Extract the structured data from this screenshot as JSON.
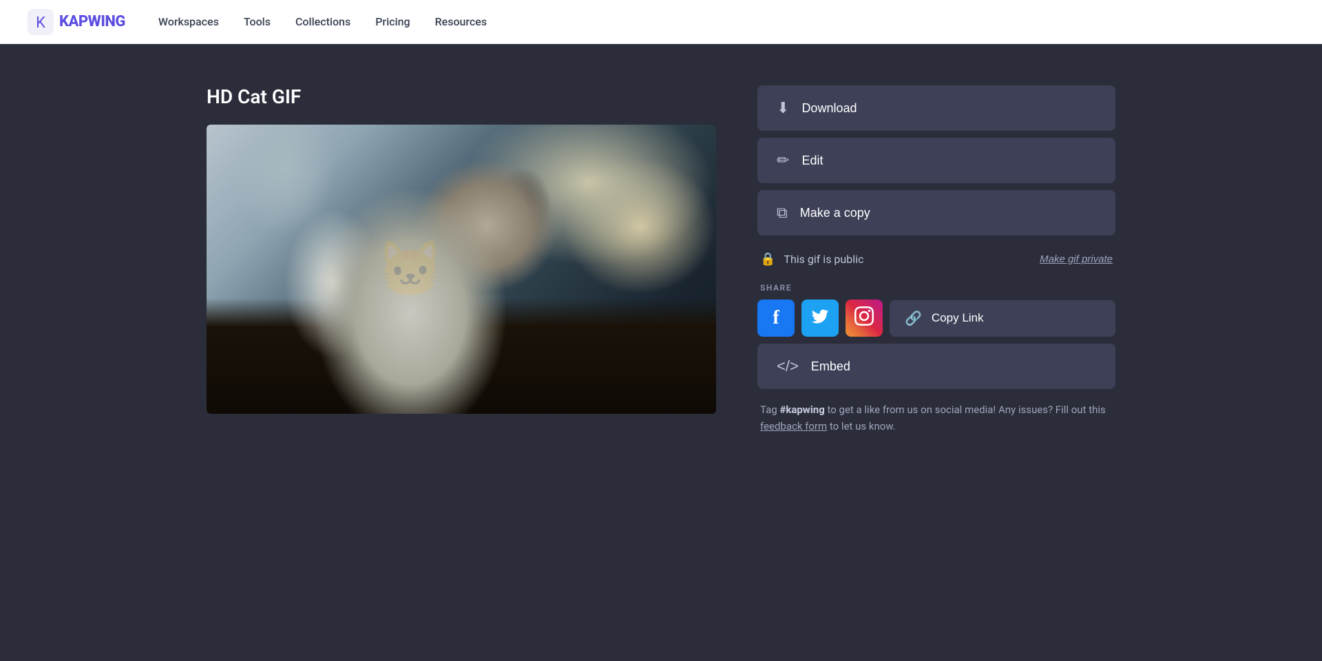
{
  "nav": {
    "logo_text": "KAPWING",
    "links": [
      {
        "id": "workspaces",
        "label": "Workspaces"
      },
      {
        "id": "tools",
        "label": "Tools"
      },
      {
        "id": "collections",
        "label": "Collections"
      },
      {
        "id": "pricing",
        "label": "Pricing"
      },
      {
        "id": "resources",
        "label": "Resources"
      }
    ]
  },
  "page": {
    "title": "HD Cat GIF"
  },
  "actions": {
    "download_label": "Download",
    "edit_label": "Edit",
    "make_copy_label": "Make a copy",
    "visibility_label": "This gif is public",
    "make_private_label": "Make gif private",
    "copy_link_label": "Copy Link",
    "embed_label": "Embed"
  },
  "share": {
    "label": "SHARE",
    "facebook_label": "f",
    "twitter_label": "🐦",
    "instagram_label": "📷"
  },
  "footer_tag": {
    "prefix": "Tag ",
    "hashtag": "#kapwing",
    "middle": " to get a like from us on social media! Any issues? Fill out this ",
    "link_text": "feedback form",
    "suffix": " to let us know."
  }
}
